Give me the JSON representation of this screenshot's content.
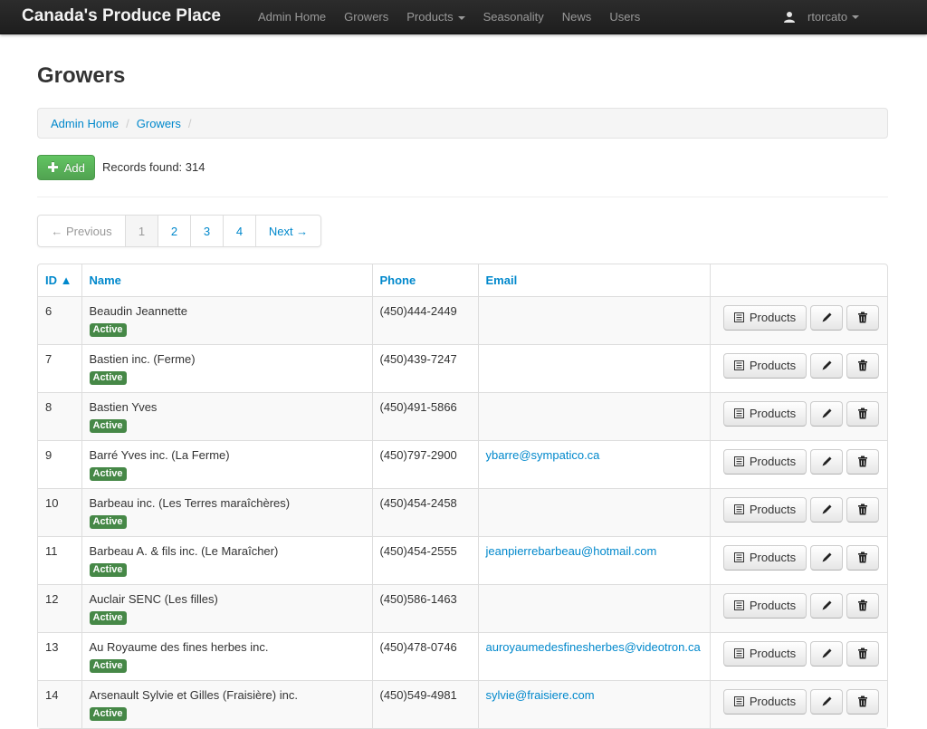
{
  "app": {
    "brand": "Canada's Produce Place"
  },
  "nav": {
    "items": [
      "Admin Home",
      "Growers",
      "Products",
      "Seasonality",
      "News",
      "Users"
    ],
    "user": "rtorcato"
  },
  "page": {
    "title": "Growers",
    "breadcrumb": [
      "Admin Home",
      "Growers"
    ],
    "add_label": "Add",
    "records_label": "Records found: 314"
  },
  "pagination": {
    "previous": "← Previous",
    "pages": [
      "1",
      "2",
      "3",
      "4"
    ],
    "active_page": "1",
    "next": "Next →"
  },
  "table": {
    "headers": {
      "id": "ID ▲",
      "name": "Name",
      "phone": "Phone",
      "email": "Email"
    },
    "products_label": "Products",
    "rows": [
      {
        "id": "6",
        "name": "Beaudin Jeannette",
        "status": "Active",
        "phone": "(450)444-2449",
        "email": ""
      },
      {
        "id": "7",
        "name": "Bastien inc. (Ferme)",
        "status": "Active",
        "phone": "(450)439-7247",
        "email": ""
      },
      {
        "id": "8",
        "name": "Bastien Yves",
        "status": "Active",
        "phone": "(450)491-5866",
        "email": ""
      },
      {
        "id": "9",
        "name": "Barré Yves inc. (La Ferme)",
        "status": "Active",
        "phone": "(450)797-2900",
        "email": "ybarre@sympatico.ca"
      },
      {
        "id": "10",
        "name": "Barbeau inc. (Les Terres maraîchères)",
        "status": "Active",
        "phone": "(450)454-2458",
        "email": ""
      },
      {
        "id": "11",
        "name": "Barbeau A. & fils inc. (Le Maraîcher)",
        "status": "Active",
        "phone": "(450)454-2555",
        "email": "jeanpierrebarbeau@hotmail.com"
      },
      {
        "id": "12",
        "name": "Auclair SENC (Les filles)",
        "status": "Active",
        "phone": "(450)586-1463",
        "email": ""
      },
      {
        "id": "13",
        "name": "Au Royaume des fines herbes inc.",
        "status": "Active",
        "phone": "(450)478-0746",
        "email": "auroyaumedesfinesherbes@videotron.ca"
      },
      {
        "id": "14",
        "name": "Arsenault Sylvie et Gilles (Fraisière) inc.",
        "status": "Active",
        "phone": "(450)549-4981",
        "email": "sylvie@fraisiere.com"
      }
    ]
  },
  "colors": {
    "navbar": "#1e1e1e",
    "link": "#0088cc",
    "add_button": "#51a351",
    "active_badge": "#468847"
  },
  "icons": [
    "user-icon",
    "plus-icon",
    "list-icon",
    "pencil-icon",
    "trash-icon",
    "caret-down-icon"
  ]
}
